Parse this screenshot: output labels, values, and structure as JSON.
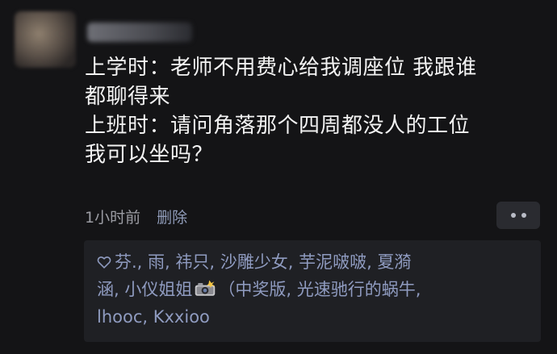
{
  "post": {
    "username_blurred": "",
    "text_lines": [
      "上学时：老师不用费心给我调座位 我跟谁",
      "都聊得来",
      "上班时：请问角落那个四周都没人的工位",
      "我可以坐吗？"
    ]
  },
  "meta": {
    "time": "1小时前",
    "delete_label": "删除"
  },
  "likes": {
    "line1": "芬., 雨, 祎只, 沙雕少女, 芋泥啵啵, 夏漪",
    "line2_before_icon": "涵, 小仪姐姐",
    "line2_after_icon": "（中奖版, 光速驰行的蜗牛,",
    "line3": "lhooc, Kxxioo",
    "icons": {
      "heart": "heart-outline-icon",
      "camera": "camera-flash-emoji-icon"
    }
  },
  "colors": {
    "background": "#141416",
    "text": "#f3f3f3",
    "meta": "#9b9ca3",
    "link": "#8f9bb8",
    "likes_panel": "#1f2024"
  }
}
